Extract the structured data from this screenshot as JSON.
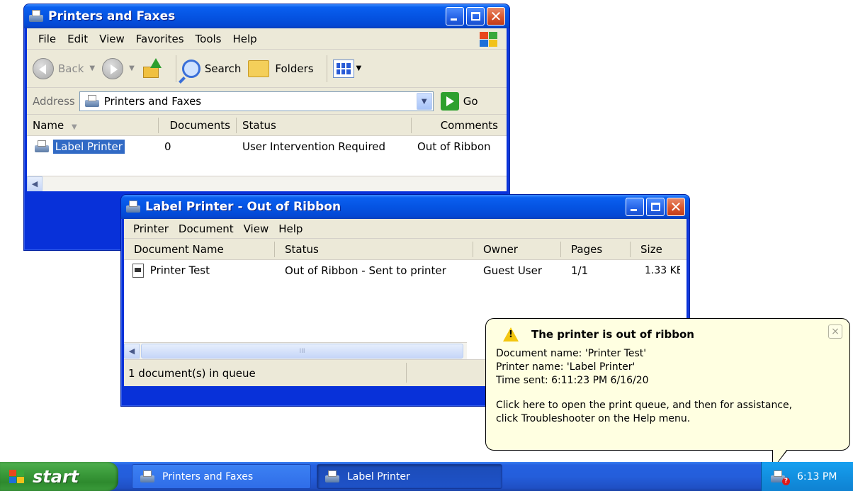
{
  "colors": {
    "titlebar": "#0554e3",
    "selection": "#316ac5",
    "balloon_bg": "#ffffe1",
    "taskbar": "#245edb",
    "start_button": "#3a9a3a"
  },
  "printers_window": {
    "title": "Printers and Faxes",
    "title_icon": "printers-folder-icon",
    "menu": [
      "File",
      "Edit",
      "View",
      "Favorites",
      "Tools",
      "Help"
    ],
    "toolbar": {
      "back_label": "Back",
      "search_label": "Search",
      "folders_label": "Folders"
    },
    "address": {
      "label": "Address",
      "value": "Printers and Faxes",
      "go_label": "Go"
    },
    "columns": [
      "Name",
      "Documents",
      "Status",
      "Comments"
    ],
    "rows": [
      {
        "name": "Label Printer",
        "documents": "0",
        "status": "User Intervention Required",
        "comments": "Out of Ribbon"
      }
    ]
  },
  "queue_window": {
    "title": "Label Printer - Out of Ribbon",
    "menu": [
      "Printer",
      "Document",
      "View",
      "Help"
    ],
    "columns": [
      "Document Name",
      "Status",
      "Owner",
      "Pages",
      "Size"
    ],
    "rows": [
      {
        "name": "Printer Test",
        "status": "Out of Ribbon - Sent to printer",
        "owner": "Guest User",
        "pages": "1/1",
        "size": "1.33 KE"
      }
    ],
    "status_text": "1 document(s) in queue",
    "scroll_thumb": "III"
  },
  "balloon": {
    "title": "The printer is out of ribbon",
    "close_symbol": "×",
    "lines": [
      "Document name: 'Printer Test'",
      "Printer name: 'Label Printer'",
      "Time sent: 6:11:23 PM  6/16/20"
    ],
    "help_lines": [
      "Click here to open the print queue, and then for assistance,",
      "click Troubleshooter on the Help menu."
    ]
  },
  "taskbar": {
    "start_label": "start",
    "buttons": [
      {
        "label": "Printers and Faxes",
        "icon": "printers-folder-icon",
        "active": false
      },
      {
        "label": "Label Printer",
        "icon": "printer-icon",
        "active": true
      }
    ],
    "clock": "6:13 PM",
    "tray_icon": "printer-alert-icon"
  }
}
